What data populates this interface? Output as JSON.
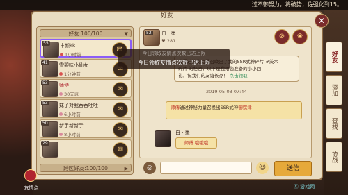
{
  "topbar": {
    "text": "过不御努力，将破势，佐强化到15。"
  },
  "panel": {
    "title": "好友"
  },
  "list": {
    "header": "好友:100/100",
    "footer": "跨区好友:100/100",
    "rows": [
      {
        "level": "55",
        "name": "丰颜kk",
        "status": "1小时前",
        "status_color": "#d9534f",
        "selected": true
      },
      {
        "level": "41",
        "name": "雪碧味小仙女",
        "status": "1分钟前",
        "status_color": "#d9534f",
        "selected": false
      },
      {
        "level": "53",
        "name": "师傅",
        "status": "30天以上",
        "status_color": "#d98a9c",
        "selected": false,
        "name_red": true
      },
      {
        "level": "53",
        "name": "妹子对我吞吞吐吐",
        "status": "6小时前",
        "status_color": "#d98a9c",
        "selected": false
      },
      {
        "level": "50",
        "name": "新手新新手",
        "status": "8小时前",
        "status_color": "#d98a9c",
        "selected": false
      },
      {
        "level": "29",
        "name": "",
        "status": "",
        "status_color": "#d98a9c",
        "selected": false
      }
    ]
  },
  "chat": {
    "user": {
      "level": "52",
      "name": "白 · 墨",
      "points": "281"
    },
    "bubble": {
      "line1": "我通过神秘力量召唤出了我的SSR式神碎片 #茨木",
      "line2": "碎片 的秘密，以下是我给您准备的小小回",
      "line3": "礼，祝我们的友谊长存！",
      "link": "点击领取"
    },
    "timestamp": "2019-05-03 07:44",
    "system_msg": {
      "prefix": "师傅",
      "middle": "通过神秘力量召唤出SSR式神",
      "highlight": "御馔津"
    },
    "reply": {
      "name": "白 · 墨",
      "message": "师傅 哦哦哦"
    },
    "toast": {
      "text": "今日领取友情点次数已达上限"
    },
    "input_placeholder": "",
    "send": "送信"
  },
  "side_tabs": [
    "好友",
    "添加",
    "查找",
    "协战"
  ],
  "bottom": {
    "friend_points": "友情点"
  },
  "watermark": "Ⓒ 游戏网"
}
